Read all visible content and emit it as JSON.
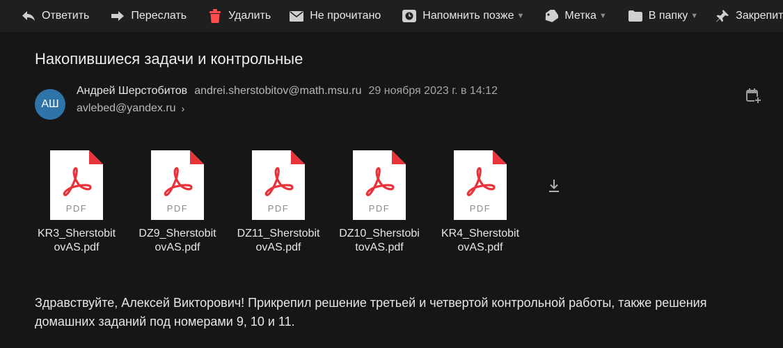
{
  "toolbar": {
    "reply": "Ответить",
    "forward": "Переслать",
    "delete": "Удалить",
    "unread": "Не прочитано",
    "remind_later": "Напомнить позже",
    "label": "Метка",
    "to_folder": "В папку",
    "pin": "Закрепить"
  },
  "message": {
    "subject": "Накопившиеся задачи и контрольные",
    "avatar_initials": "АШ",
    "sender_name": "Андрей Шерстобитов",
    "sender_email": "andrei.sherstobitov@math.msu.ru",
    "date": "29 ноября 2023 г. в 14:12",
    "recipient": "avlebed@yandex.ru",
    "body": "Здравствуйте, Алексей Викторович! Прикрепил решение третьей и четвертой контрольной работы, также решения домашних заданий под номерами 9, 10 и 11."
  },
  "attachments": [
    {
      "name": "KR3_SherstobitovAS.pdf",
      "type": "PDF"
    },
    {
      "name": "DZ9_SherstobitovAS.pdf",
      "type": "PDF"
    },
    {
      "name": "DZ11_SherstobitovAS.pdf",
      "type": "PDF"
    },
    {
      "name": "DZ10_SherstobitovAS.pdf",
      "type": "PDF"
    },
    {
      "name": "KR4_SherstobitovAS.pdf",
      "type": "PDF"
    }
  ],
  "colors": {
    "background": "#161616",
    "toolbar": "#1f1f1f",
    "avatar": "#2f74a8",
    "pdf_red": "#e8333a",
    "delete_icon": "#ff4d4d"
  },
  "icons": [
    "reply-icon",
    "forward-icon",
    "trash-icon",
    "envelope-icon",
    "clock-icon",
    "tag-icon",
    "folder-icon",
    "pin-icon",
    "calendar-add-icon",
    "download-icon",
    "pdf-icon"
  ]
}
